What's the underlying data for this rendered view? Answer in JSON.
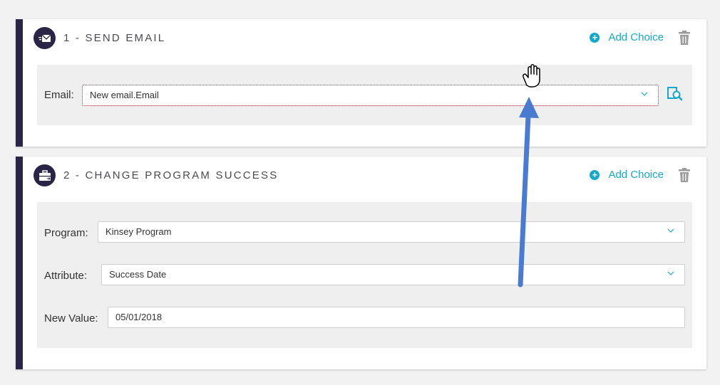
{
  "steps": [
    {
      "title": "1 - SEND EMAIL",
      "icon": "email-send-icon",
      "add_choice_label": "Add Choice",
      "fields": [
        {
          "label": "Email:",
          "value": "New email.Email",
          "type": "select",
          "error": true
        }
      ]
    },
    {
      "title": "2 - CHANGE PROGRAM SUCCESS",
      "icon": "briefcase-icon",
      "add_choice_label": "Add Choice",
      "fields": [
        {
          "label": "Program:",
          "value": "Kinsey Program",
          "type": "select"
        },
        {
          "label": "Attribute:",
          "value": "Success Date",
          "type": "select"
        },
        {
          "label": "New Value:",
          "value": "05/01/2018",
          "type": "text"
        }
      ]
    }
  ],
  "colors": {
    "accent": "#14a9cc",
    "step_bar": "#2a2446",
    "error": "#c0282d",
    "arrow": "#4a7bd0"
  }
}
